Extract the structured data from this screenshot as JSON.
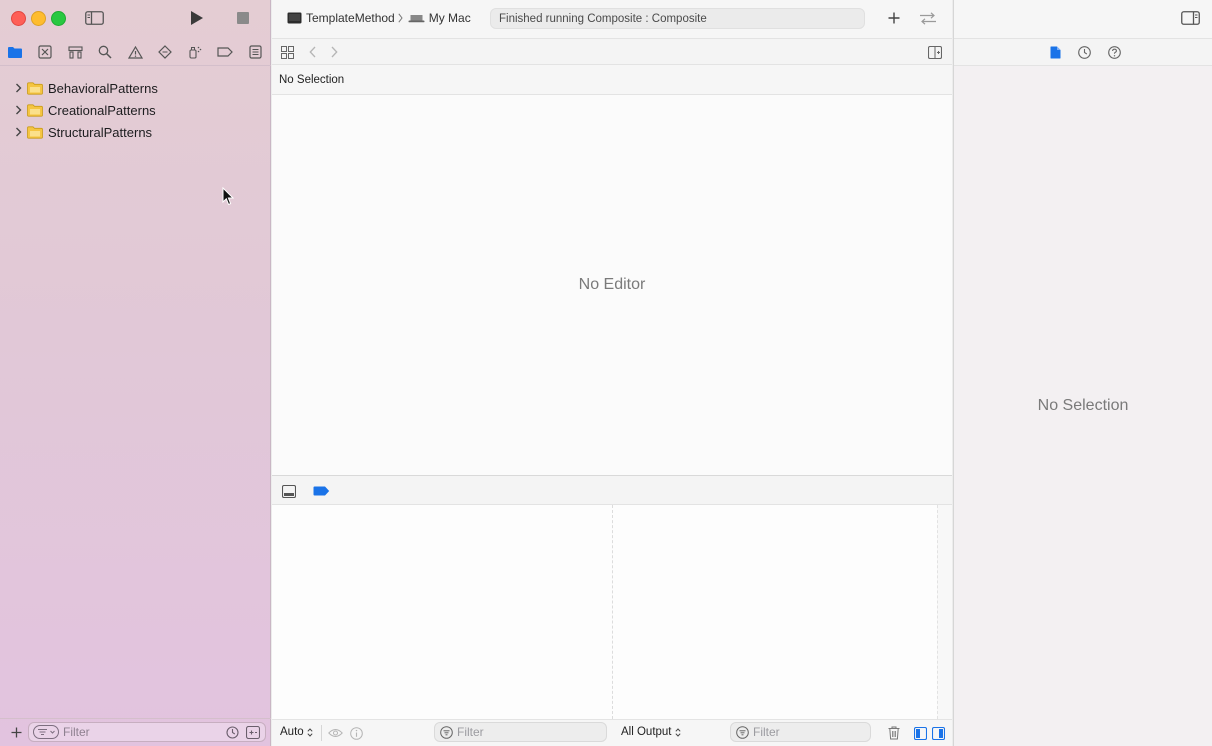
{
  "toolbar": {
    "scheme_target": "TemplateMethod",
    "destination": "My Mac",
    "activity_status": "Finished running Composite : Composite"
  },
  "navigator": {
    "tree": [
      {
        "label": "BehavioralPatterns",
        "expanded": false,
        "icon": "folder-icon"
      },
      {
        "label": "CreationalPatterns",
        "expanded": false,
        "icon": "folder-icon"
      },
      {
        "label": "StructuralPatterns",
        "expanded": false,
        "icon": "folder-icon"
      }
    ],
    "filter_placeholder": "Filter"
  },
  "editor": {
    "jump_bar": "No Selection",
    "empty_message": "No Editor"
  },
  "debug_area": {
    "variables_scope": "Auto",
    "variables_filter_placeholder": "Filter",
    "console_output": "All Output",
    "console_filter_placeholder": "Filter"
  },
  "inspector": {
    "empty_message": "No Selection"
  },
  "colors": {
    "accent": "#1a73e8",
    "folder": "#f5c542",
    "close": "#fe5f57",
    "minimize": "#febc2e",
    "zoom": "#28c840"
  }
}
